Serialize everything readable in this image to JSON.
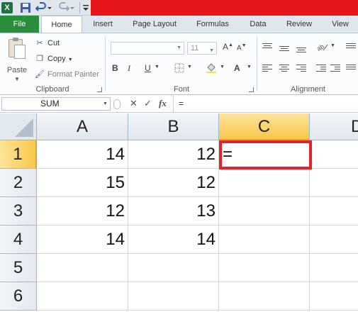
{
  "qat": {
    "app_icon_letter": "X"
  },
  "tabs": [
    "File",
    "Home",
    "Insert",
    "Page Layout",
    "Formulas",
    "Data",
    "Review",
    "View"
  ],
  "ribbon": {
    "clipboard": {
      "paste": "Paste",
      "cut": "Cut",
      "copy": "Copy",
      "format_painter": "Format Painter",
      "group_label": "Clipboard"
    },
    "font": {
      "font_name": "",
      "font_size": "11",
      "group_label": "Font",
      "bold": "B",
      "italic": "I",
      "underline": "U"
    },
    "alignment": {
      "group_label": "Alignment"
    }
  },
  "formula_bar": {
    "name_box": "SUM",
    "formula": "="
  },
  "grid": {
    "columns": [
      "A",
      "B",
      "C",
      "D"
    ],
    "rows": [
      "1",
      "2",
      "3",
      "4",
      "5",
      "6"
    ],
    "cells": {
      "A1": "14",
      "B1": "12",
      "C1": "=",
      "A2": "15",
      "B2": "12",
      "A3": "12",
      "B3": "13",
      "A4": "14",
      "B4": "14"
    },
    "active_cell": "C1"
  },
  "colors": {
    "file_tab": "#2a8d3c",
    "title_bar": "#e8141b",
    "highlight_box": "#e2232a",
    "selected_header": "#f7c84a"
  }
}
